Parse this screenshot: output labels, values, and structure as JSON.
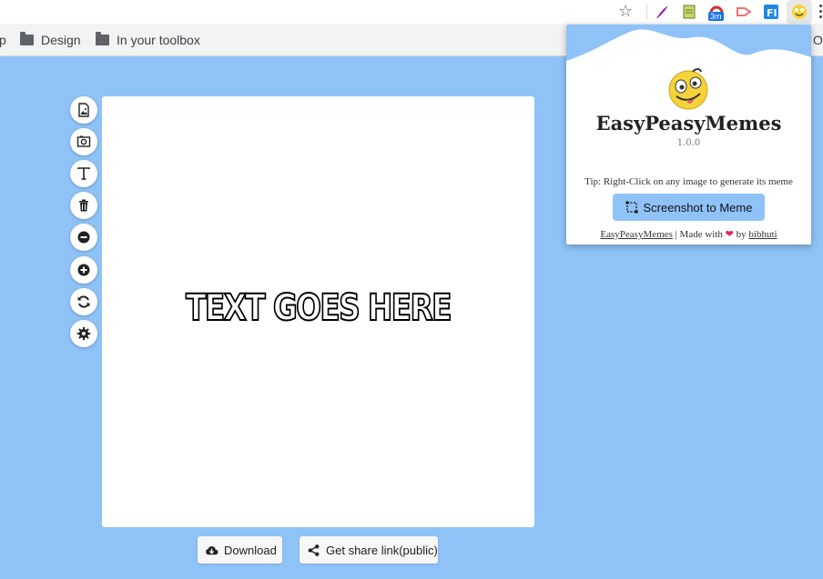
{
  "browser": {
    "bookmarks": [
      {
        "label": "p"
      },
      {
        "label": "Design",
        "icon": "folder-icon"
      },
      {
        "label": "In your toolbox",
        "icon": "folder-icon"
      },
      {
        "label": "O"
      }
    ],
    "extensions": [
      "quill-extension-icon",
      "sheet-extension-icon",
      "timer-extension-icon",
      "cast-extension-icon",
      "fi-extension-icon",
      "easypeasymemes-extension-icon"
    ],
    "extension_badge": "3m",
    "star_icon": "bookmark-star-icon",
    "menu_icon": "more-vert-icon"
  },
  "editor": {
    "tools": [
      {
        "name": "add-image-button",
        "icon": "image-icon"
      },
      {
        "name": "screenshot-button",
        "icon": "camera-icon"
      },
      {
        "name": "add-text-button",
        "icon": "text-icon"
      },
      {
        "name": "delete-button",
        "icon": "trash-icon"
      },
      {
        "name": "zoom-out-button",
        "icon": "minus-circle-icon"
      },
      {
        "name": "zoom-in-button",
        "icon": "plus-circle-icon"
      },
      {
        "name": "reset-button",
        "icon": "refresh-icon"
      },
      {
        "name": "settings-button",
        "icon": "gear-icon"
      }
    ],
    "canvas_text": "TEXT GOES HERE",
    "download_label": "Download",
    "share_label": "Get share link(public)"
  },
  "popup": {
    "title": "EasyPeasyMemes",
    "version": "1.0.0",
    "tip": "Tip: Right-Click on any image to generate its meme",
    "cta_label": "Screenshot to Meme",
    "footer_link": "EasyPeasyMemes",
    "footer_sep": " | Made with ",
    "footer_heart": "❤",
    "footer_by": " by ",
    "footer_author": "bibhuti"
  },
  "colors": {
    "background": "#8fc3f8",
    "popup_accent": "#8fc3f8",
    "heart": "#e0245e"
  }
}
